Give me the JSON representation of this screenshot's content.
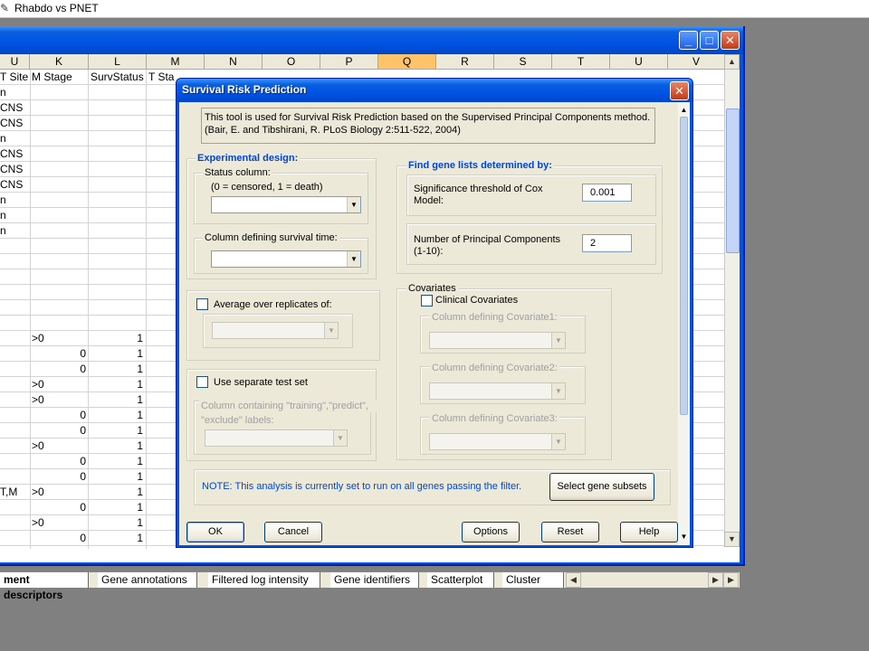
{
  "app": {
    "title": "Rhabdo vs PNET"
  },
  "workbook": {
    "columns": [
      "U",
      "K",
      "L",
      "M",
      "N",
      "O",
      "P",
      "Q",
      "R",
      "S",
      "T",
      "U",
      "V"
    ],
    "selected_column": "Q",
    "row1": {
      "U": "T Site",
      "K": "M Stage",
      "L": "SurvStatus",
      "M": "T Sta"
    },
    "col_u_values": [
      "n",
      "CNS",
      "CNS",
      "n",
      "CNS",
      "CNS",
      "CNS",
      "n",
      "n",
      "n",
      "",
      "",
      "",
      "",
      "",
      "",
      "",
      "",
      "",
      "",
      "",
      "",
      "",
      "",
      "",
      "",
      "T,M"
    ],
    "col_k_values": [
      ">0",
      "0",
      "0",
      ">0",
      ">0",
      "0",
      "0",
      ">0",
      "0",
      "0",
      ">0",
      "0",
      ">0",
      "0"
    ],
    "col_l_values": [
      "1",
      "1",
      "1",
      "1",
      "1",
      "1",
      "1",
      "1",
      "1",
      "1",
      "1",
      "1",
      "1",
      "1"
    ],
    "tabs": [
      "ment descriptors",
      "Gene annotations",
      "Filtered log intensity",
      "Gene identifiers",
      "Scatterplot",
      "Cluster viet"
    ]
  },
  "dialog": {
    "title": "Survival Risk Prediction",
    "info_line1": "This tool is used for Survival Risk Prediction based on the Supervised Principal Components method.",
    "info_line2": "(Bair, E. and Tibshirani, R. PLoS Biology 2:511-522, 2004)",
    "experimental_design": {
      "legend": "Experimental design:",
      "status_label": "Status column:",
      "status_hint": "(0 = censored, 1 = death)",
      "status_value": "",
      "survival_time_label": "Column defining survival time:",
      "survival_time_value": ""
    },
    "average": {
      "label": "Average over replicates of:",
      "checked": false,
      "value": ""
    },
    "test_set": {
      "label": "Use separate test set",
      "checked": false,
      "column_label_line1": "Column containing \"training\",\"predict\",",
      "column_label_line2": "\"exclude\" labels:",
      "value": ""
    },
    "gene_lists": {
      "legend": "Find gene lists determined by:",
      "significance_label_line1": "Significance threshold of Cox",
      "significance_label_line2": "Model:",
      "significance_value": "0.001",
      "components_label_line1": "Number of Principal Components",
      "components_label_line2": "(1-10):",
      "components_value": "2"
    },
    "covariates": {
      "legend": "Covariates",
      "clinical_label": "Clinical Covariates",
      "clinical_checked": false,
      "cov1_label": "Column defining Covariate1:",
      "cov2_label": "Column defining Covariate2:",
      "cov3_label": "Column defining Covariate3:"
    },
    "note": "NOTE:  This analysis is currently set to run on all genes passing the filter.",
    "buttons": {
      "select_gene_subsets": "Select gene subsets",
      "ok": "OK",
      "cancel": "Cancel",
      "options": "Options",
      "reset": "Reset",
      "help": "Help"
    }
  },
  "colors": {
    "xp_blue": "#0054e3",
    "dialog_face": "#ece9d8",
    "legend_blue": "#0046d5",
    "note_blue": "#0046d5",
    "selected_header": "#ffc469"
  },
  "icons": {
    "app": "excel-icon",
    "minimize": "minimize-icon",
    "maximize": "maximize-icon",
    "close": "close-icon",
    "dropdown": "chevron-down-icon"
  }
}
